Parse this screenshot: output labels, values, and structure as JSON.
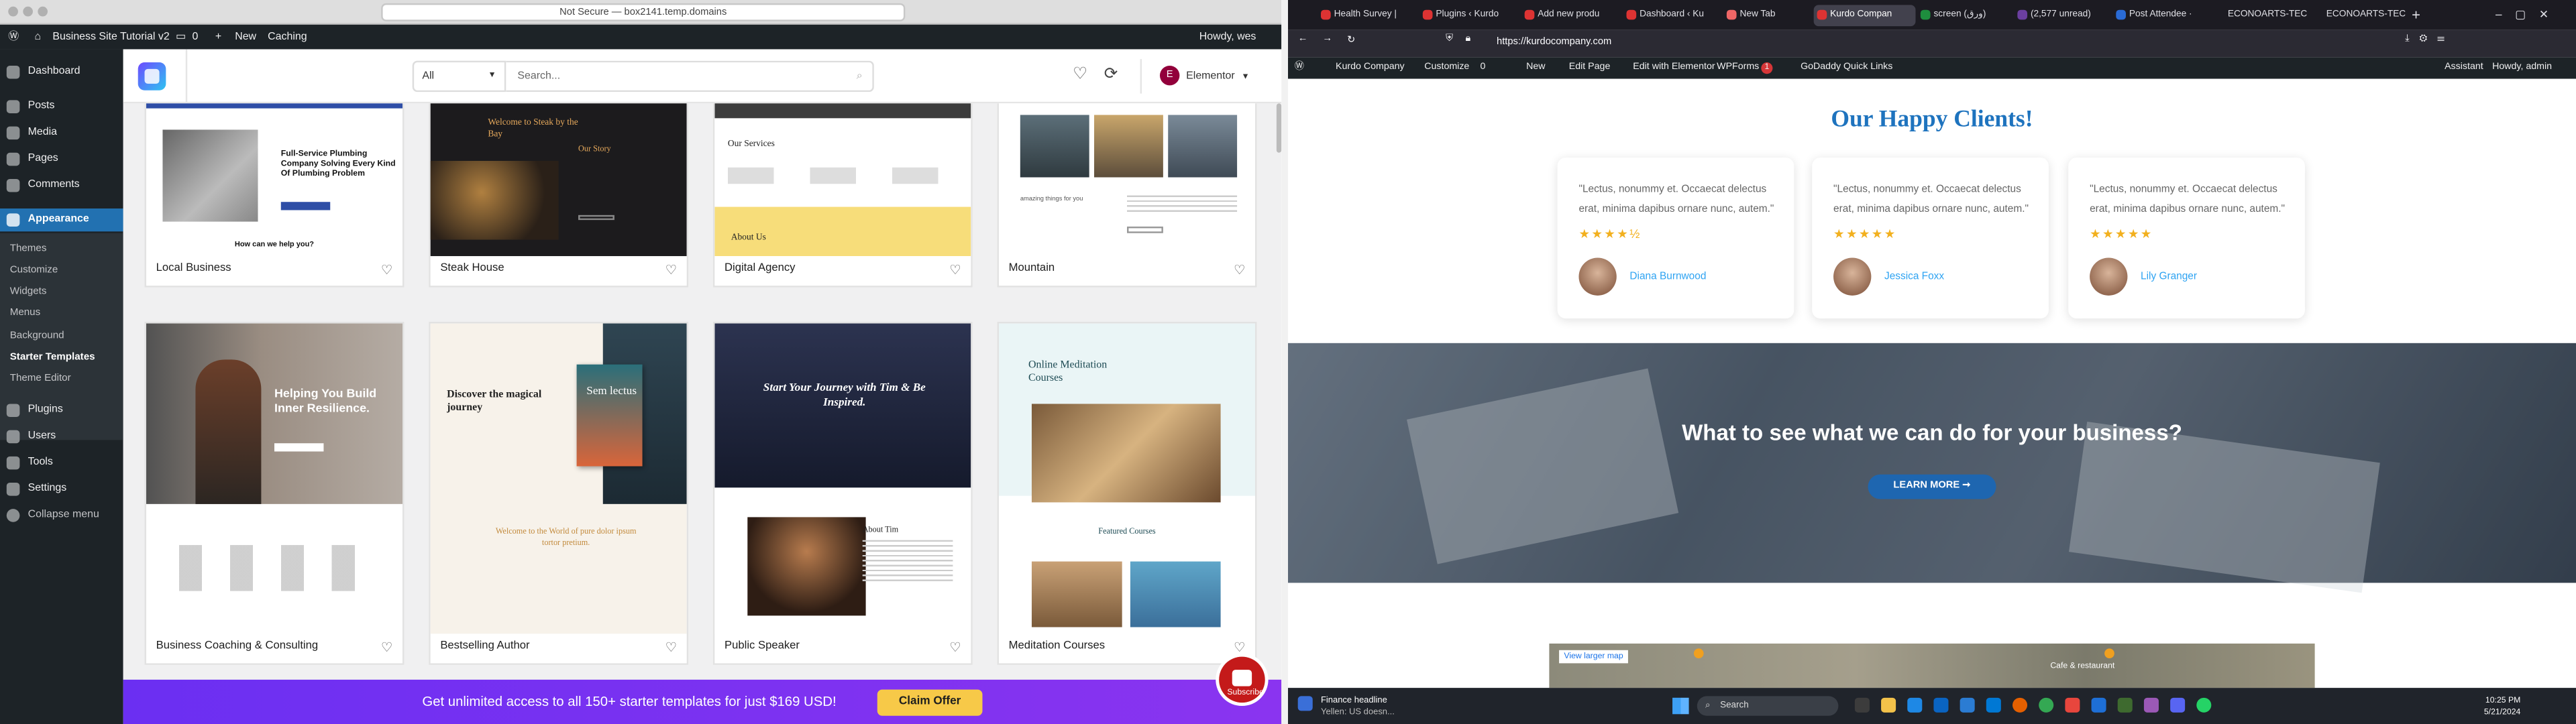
{
  "left_window": {
    "url": "Not Secure — box2141.temp.domains",
    "admin_bar": {
      "site_name": "Business Site Tutorial v2",
      "comments_count": "0",
      "new_label": "New",
      "caching_label": "Caching",
      "howdy": "Howdy, wes"
    },
    "sidebar": {
      "dashboard": "Dashboard",
      "posts": "Posts",
      "media": "Media",
      "pages": "Pages",
      "comments": "Comments",
      "appearance": "Appearance",
      "sub": [
        "Themes",
        "Customize",
        "Widgets",
        "Menus",
        "Background",
        "Starter Templates",
        "Theme Editor"
      ],
      "plugins": "Plugins",
      "users": "Users",
      "tools": "Tools",
      "settings": "Settings",
      "collapse": "Collapse menu"
    },
    "header": {
      "filter_value": "All",
      "search_placeholder": "Search...",
      "builder_label": "Elementor"
    },
    "templates": [
      {
        "name": "Local Business"
      },
      {
        "name": "Steak House"
      },
      {
        "name": "Digital Agency"
      },
      {
        "name": "Mountain"
      },
      {
        "name": "Business Coaching & Consulting"
      },
      {
        "name": "Bestselling Author"
      },
      {
        "name": "Public Speaker"
      },
      {
        "name": "Meditation Courses"
      }
    ],
    "thumb_text": {
      "local_business": "Full-Service Plumbing Company Solving Every Kind Of Plumbing Problem",
      "local_help": "How can we help you?",
      "steak_title": "Welcome to Steak by the Bay",
      "steak_story": "Our Story",
      "digital_services": "Our Services",
      "digital_about": "About Us",
      "mountain_tag": "amazing things for you",
      "coach_headline": "Helping You Build Inner Resilience.",
      "author_headline": "Discover the magical journey",
      "author_book": "Sem lectus",
      "author_welcome": "Welcome to the World of pure dolor ipsum tortor pretium.",
      "speaker_headline": "Start Your Journey with Tim & Be Inspired.",
      "speaker_about": "About Tim",
      "meditation_headline": "Online Meditation Courses",
      "meditation_featured": "Featured Courses"
    },
    "promo": {
      "text": "Get unlimited access to all 150+ starter templates for just $169 USD!",
      "button": "Claim Offer",
      "youtube": "Subscribe"
    }
  },
  "right_window": {
    "tabs": [
      "Health Survey |",
      "Plugins ‹ Kurdo",
      "Add new produ",
      "Dashboard ‹ Ku",
      "New Tab",
      "Kurdo Compan",
      "screen (ورق)",
      "(2,577 unread)",
      "Post Attendee ·",
      "ECONOARTS-TECH",
      "ECONOARTS-TECH"
    ],
    "active_tab_index": 5,
    "url": "https://kurdocompany.com",
    "admin_bar": {
      "site": "Kurdo Company",
      "customize": "Customize",
      "comments": "0",
      "new": "New",
      "edit_page": "Edit Page",
      "edit_elementor": "Edit with Elementor",
      "wpforms": "WPForms",
      "wpforms_badge": "1",
      "godaddy": "GoDaddy Quick Links",
      "assistant": "Assistant",
      "howdy": "Howdy, admin"
    },
    "clients_heading": "Our Happy Clients!",
    "testimonials": [
      {
        "quote": "\"Lectus, nonummy et. Occaecat delectus erat, minima dapibus ornare nunc, autem.\"",
        "stars": "★★★★½",
        "name": "Diana Burnwood"
      },
      {
        "quote": "\"Lectus, nonummy et. Occaecat delectus erat, minima dapibus ornare nunc, autem.\"",
        "stars": "★★★★★",
        "name": "Jessica Foxx"
      },
      {
        "quote": "\"Lectus, nonummy et. Occaecat delectus erat, minima dapibus ornare nunc, autem.\"",
        "stars": "★★★★★",
        "name": "Lily Granger"
      }
    ],
    "hero": {
      "title": "What to see what we can do for your business?",
      "button": "LEARN MORE ➞"
    },
    "map": {
      "view_larger": "View larger map",
      "place": "Cafe & restaurant"
    },
    "taskbar": {
      "news_title": "Finance headline",
      "news_sub": "Yellen: US doesn...",
      "search": "Search",
      "time": "10:25 PM",
      "date": "5/21/2024"
    }
  }
}
